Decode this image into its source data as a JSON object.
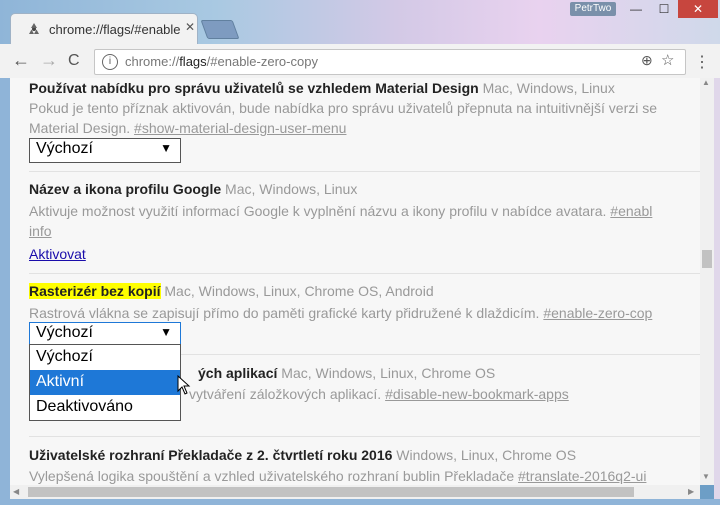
{
  "window": {
    "user_badge": "PetrTwo",
    "min_glyph": "—",
    "max_glyph": "☐",
    "close_glyph": "✕"
  },
  "tab": {
    "title": "chrome://flags/#enable-zero-copy",
    "close_glyph": "✕",
    "favicon": "experiment-icon"
  },
  "toolbar": {
    "back_glyph": "←",
    "forward_glyph": "→",
    "reload_glyph": "C",
    "url_prefix": "chrome://",
    "url_host": "flags",
    "url_rest": "/#enable-zero-copy",
    "info_glyph": "i",
    "zoom_glyph": "⊕",
    "star_glyph": "☆",
    "menu_glyph": "⋮"
  },
  "experiments": [
    {
      "title": "Používat nabídku pro správu uživatelů se vzhledem Material Design",
      "platforms": "Mac, Windows, Linux",
      "desc1": "Pokud je tento příznak aktivován, bude nabídka pro správu uživatelů přepnuta na intuitivnější verzi se",
      "desc2": "Material Design.",
      "link": "#show-material-design-user-menu",
      "select_value": "Výchozí",
      "select_arrow": "▼"
    },
    {
      "title": "Název a ikona profilu Google",
      "platforms": "Mac, Windows, Linux",
      "desc1": "Aktivuje možnost využití informací Google k vyplnění názvu a ikony profilu v nabídce avatara.",
      "link1": "#enabl",
      "desc2": "info",
      "action": "Aktivovat"
    },
    {
      "title": "Rasterizér bez kopií",
      "platforms": "Mac, Windows, Linux, Chrome OS, Android",
      "desc1": "Rastrová vlákna se zapisují přímo do paměti grafické karty přidružené k dlaždicím.",
      "link": "#enable-zero-cop",
      "select_value": "Výchozí",
      "select_arrow": "▼"
    },
    {
      "title_partial": "ých aplikací",
      "platforms": "Mac, Windows, Linux, Chrome OS",
      "desc_partial": "vytváření záložkových aplikací.",
      "link": "#disable-new-bookmark-apps"
    },
    {
      "title": "Uživatelské rozhraní Překladače z 2. čtvrtletí roku 2016",
      "platforms": "Windows, Linux, Chrome OS",
      "desc1": "Vylepšená logika spouštění a vzhled uživatelského rozhraní bublin Překladače",
      "link": "#translate-2016q2-ui"
    }
  ],
  "dropdown": {
    "options": [
      "Výchozí",
      "Aktivní",
      "Deaktivováno"
    ],
    "selected_index": 1
  }
}
